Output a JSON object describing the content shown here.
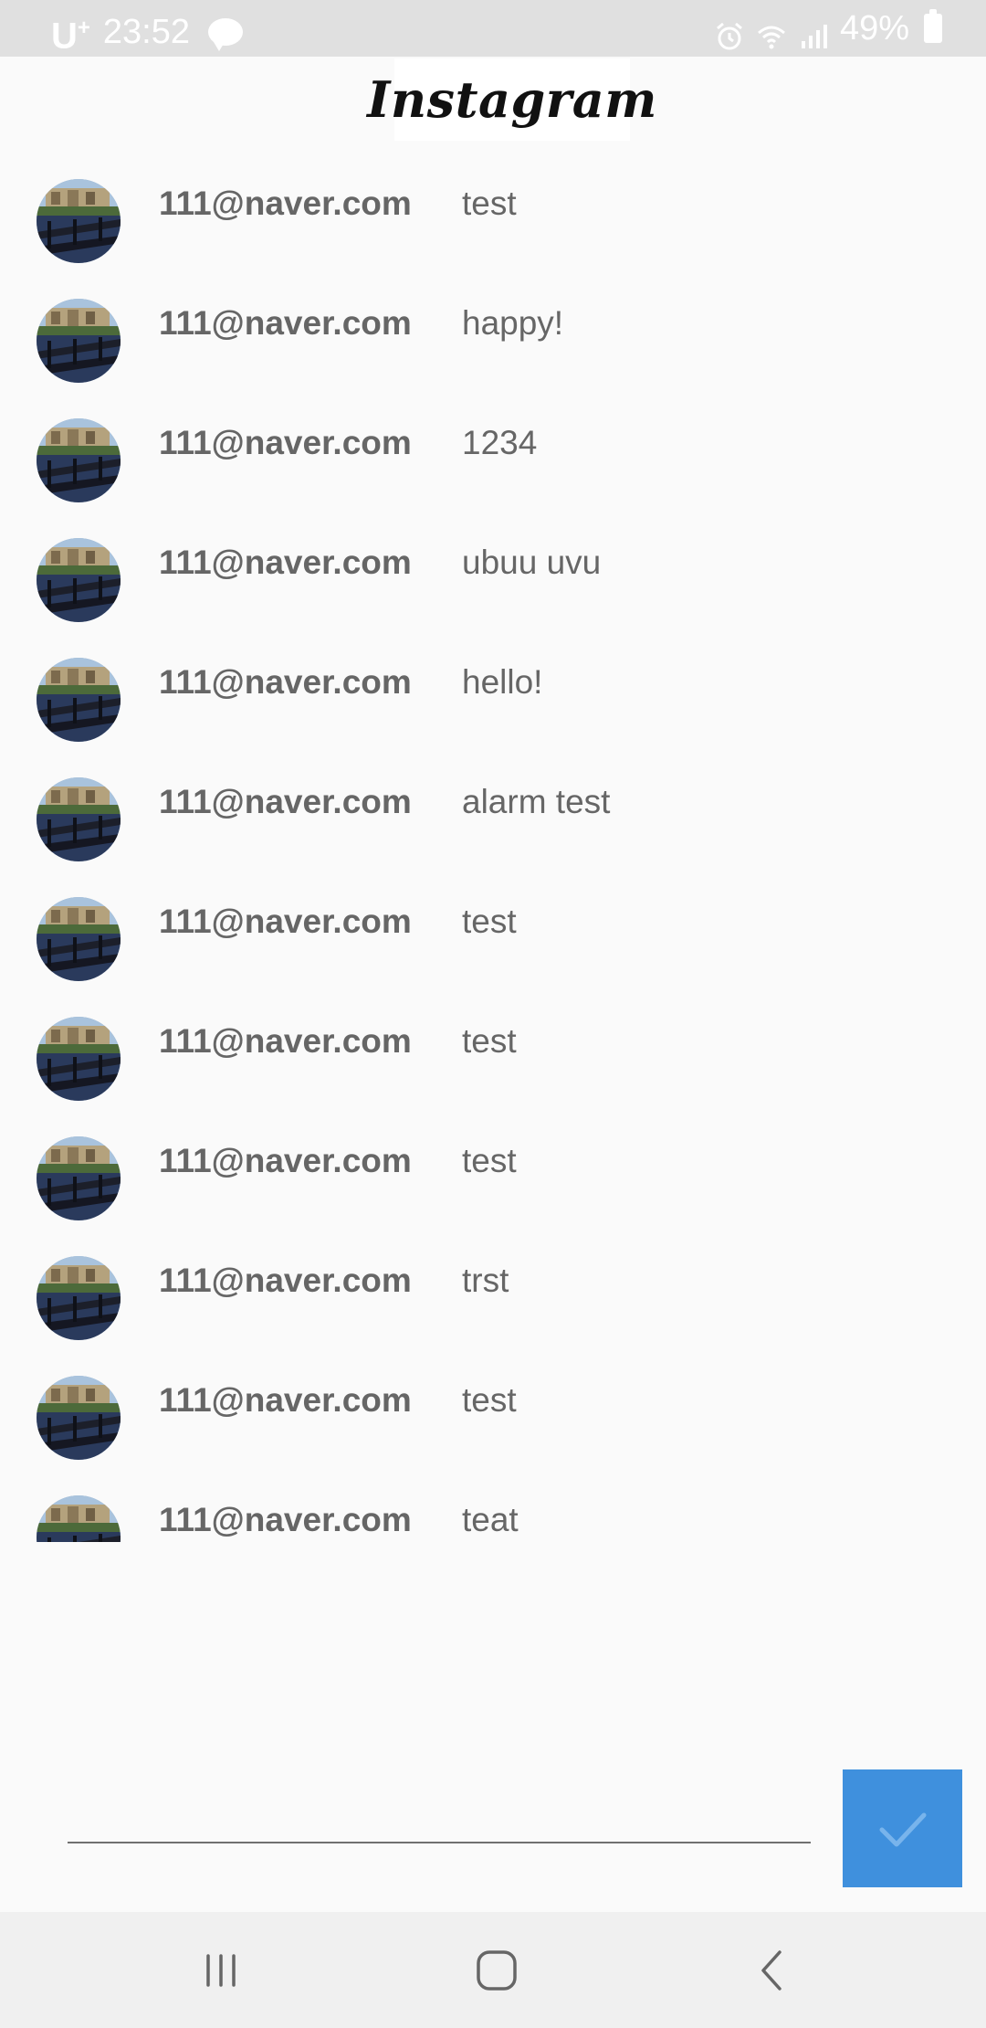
{
  "status_bar": {
    "carrier": "U",
    "carrier_sup": "+",
    "time": "23:52",
    "battery": "49%"
  },
  "header": {
    "logo_text": "Instagram"
  },
  "comments": [
    {
      "user": "111@naver.com",
      "text": "test"
    },
    {
      "user": "111@naver.com",
      "text": "happy!"
    },
    {
      "user": "111@naver.com",
      "text": "1234"
    },
    {
      "user": "111@naver.com",
      "text": "ubuu uvu"
    },
    {
      "user": "111@naver.com",
      "text": "hello!"
    },
    {
      "user": "111@naver.com",
      "text": "alarm test"
    },
    {
      "user": "111@naver.com",
      "text": "test"
    },
    {
      "user": "111@naver.com",
      "text": "test"
    },
    {
      "user": "111@naver.com",
      "text": "test"
    },
    {
      "user": "111@naver.com",
      "text": "trst"
    },
    {
      "user": "111@naver.com",
      "text": "test"
    },
    {
      "user": "111@naver.com",
      "text": "teat"
    }
  ],
  "input": {
    "value": "",
    "placeholder": ""
  },
  "icons": {
    "submit": "check-icon",
    "nav_recents": "recent-apps-icon",
    "nav_home": "home-icon",
    "nav_back": "back-icon",
    "avatar": "profile-photo"
  },
  "colors": {
    "accent": "#3f90dd",
    "status_bar": "#e0e0e0",
    "nav_bar": "#f0f0f0",
    "text": "#666666",
    "background": "#fafafa"
  }
}
